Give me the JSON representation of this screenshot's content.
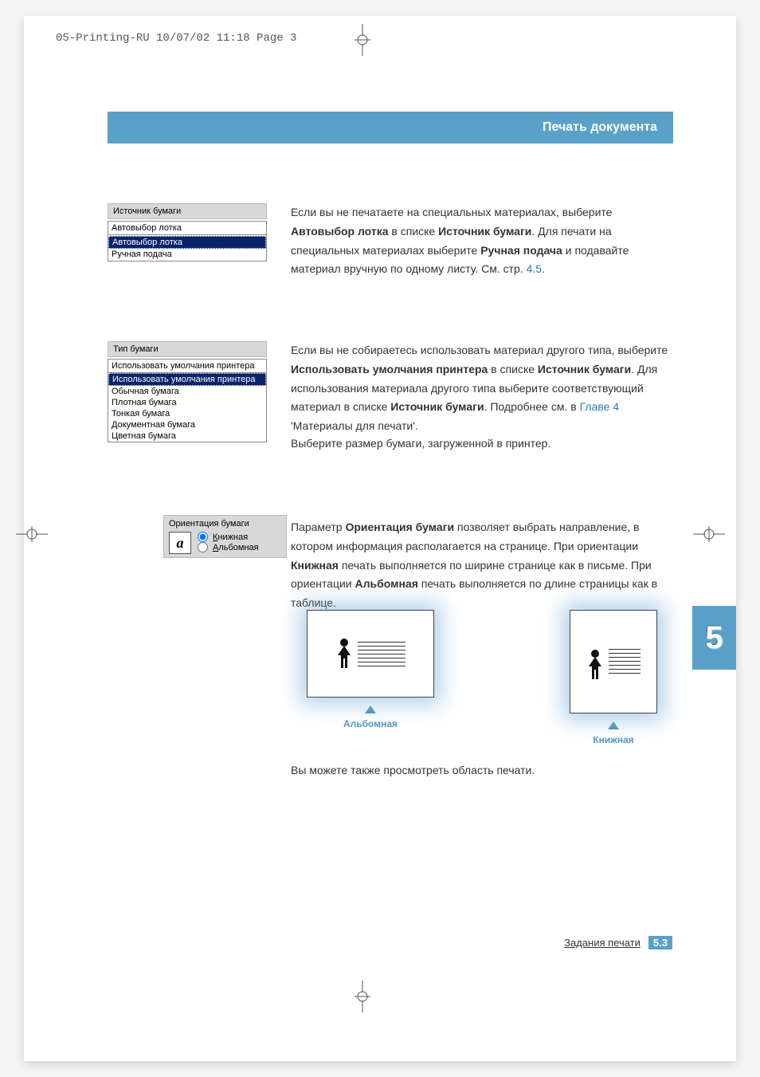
{
  "slug": "05-Printing-RU  10/07/02  11:18  Page 3",
  "header_title": "Печать документа",
  "source_widget": {
    "title": "Источник бумаги",
    "selected": "Автовыбор лотка",
    "options": [
      "Автовыбор лотка",
      "Ручная подача"
    ]
  },
  "para1": {
    "pre": "Если вы не печатаете на специальных материалах, выберите ",
    "b1": "Автовыбор лотка",
    "mid1": " в списке ",
    "b2": "Источник бумаги",
    "mid2": ". Для печати на специальных материалах выберите ",
    "b3": "Ручная подача",
    "post": " и подавайте материал вручную по одному листу. См. стр. ",
    "link": "4.5",
    "end": "."
  },
  "type_widget": {
    "title": "Тип бумаги",
    "selected": "Использовать умолчания принтера",
    "options": [
      "Использовать умолчания принтера",
      "Обычная бумага",
      "Плотная бумага",
      "Тонкая бумага",
      "Документная бумага",
      "Цветная бумага"
    ]
  },
  "para2": {
    "pre": "Если вы не собираетесь использовать материал другого типа, выберите ",
    "b1": "Использовать умолчания принтера",
    "mid1": " в списке ",
    "b2": "Источник бумаги",
    "mid2": ". Для использования материала другого типа выберите соответствующий материал в списке ",
    "b3": "Источник бумаги",
    "mid3": ". Подробнее см. в ",
    "link": "Главе 4",
    "post": " 'Материалы для печати'."
  },
  "para3": "Выберите размер бумаги, загруженной в принтер.",
  "orient_widget": {
    "title": "Ориентация бумаги",
    "opt1": "Книжная",
    "opt2": "Альбомная"
  },
  "para4": {
    "pre": "Параметр ",
    "b1": "Ориентация бумаги",
    "mid1": " позволяет выбрать направление, в котором информация располагается на странице. При ориентации ",
    "b2": "Книжная",
    "mid2": " печать выполняется по ширине странице как в письме. При ориентации ",
    "b3": "Альбомная",
    "post": " печать выполняется по длине страницы как в таблице."
  },
  "preview_labels": {
    "landscape": "Альбомная",
    "portrait": "Книжная"
  },
  "para5": "Вы можете также просмотреть область печати.",
  "chapter_number": "5",
  "footer": {
    "label": "Задания печати",
    "page": "5.3"
  }
}
